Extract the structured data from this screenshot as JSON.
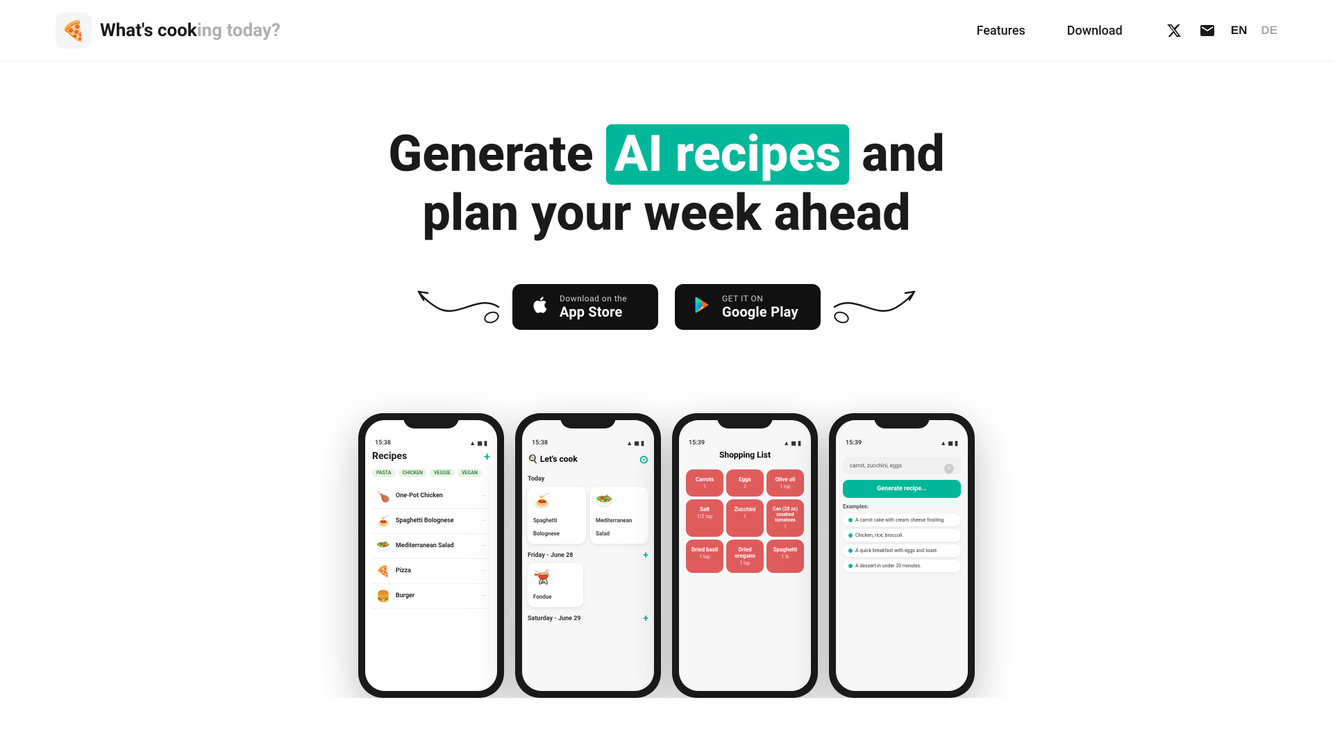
{
  "nav": {
    "logo_emoji": "🍕",
    "logo_text_dark": "What's cook",
    "logo_text_light": "ing today?",
    "links": [
      {
        "id": "features",
        "label": "Features"
      },
      {
        "id": "download",
        "label": "Download"
      }
    ],
    "lang_en": "EN",
    "lang_de": "DE"
  },
  "hero": {
    "title_before": "Generate ",
    "title_highlight": "AI recipes",
    "title_after": " and",
    "title_line2": "plan your week ahead",
    "appstore_sub": "Download on the",
    "appstore_main": "App Store",
    "googleplay_sub": "GET IT ON",
    "googleplay_main": "Google Play"
  },
  "phones": [
    {
      "id": "recipes",
      "time": "15:38",
      "screen_title": "Recipes",
      "tags": [
        "PASTA",
        "CHICKEN",
        "VEGGIE",
        "VEGAN"
      ],
      "items": [
        {
          "emoji": "🍗",
          "name": "One-Pot Chicken"
        },
        {
          "emoji": "🍝",
          "name": "Spaghetti Bolognese"
        },
        {
          "emoji": "🥗",
          "name": "Mediterranean Salad"
        },
        {
          "emoji": "🍕",
          "name": "Pizza"
        },
        {
          "emoji": "🍔",
          "name": "Burger"
        }
      ]
    },
    {
      "id": "letscook",
      "time": "15:38",
      "screen_title": "🍳 Let's cook",
      "sections": [
        {
          "label": "Today",
          "meals": [
            "Spaghetti Bolognese",
            "Mediterranean Salad"
          ]
        },
        {
          "label": "Friday - June 28",
          "meals": [
            "Fondue"
          ]
        },
        {
          "label": "Saturday - June 29",
          "meals": []
        }
      ]
    },
    {
      "id": "shopping",
      "time": "15:39",
      "screen_title": "Shopping List",
      "items": [
        {
          "name": "Carrots",
          "qty": "1"
        },
        {
          "name": "Eggs",
          "qty": "2"
        },
        {
          "name": "Olive oil",
          "qty": "1 tsp"
        },
        {
          "name": "Salt",
          "qty": "1/2 tsp"
        },
        {
          "name": "Zucchini",
          "qty": "1"
        },
        {
          "name": "Can (28 oz) crushed tomatoes",
          "qty": "1"
        },
        {
          "name": "Dried basil",
          "qty": "1 tsp"
        },
        {
          "name": "Dried oregano",
          "qty": "1 tsp"
        },
        {
          "name": "Spaghetti",
          "qty": "1 lb"
        }
      ]
    },
    {
      "id": "generate",
      "time": "15:39",
      "input_placeholder": "carrot, zucchini, eggs",
      "generate_btn": "Generate recipe...",
      "examples_label": "Examples:",
      "examples": [
        "A carrot cake with cream cheese frosting.",
        "Chicken, rice, broccoli.",
        "A quick breakfast with eggs and toast.",
        "A dessert in under 30 minutes."
      ]
    }
  ]
}
